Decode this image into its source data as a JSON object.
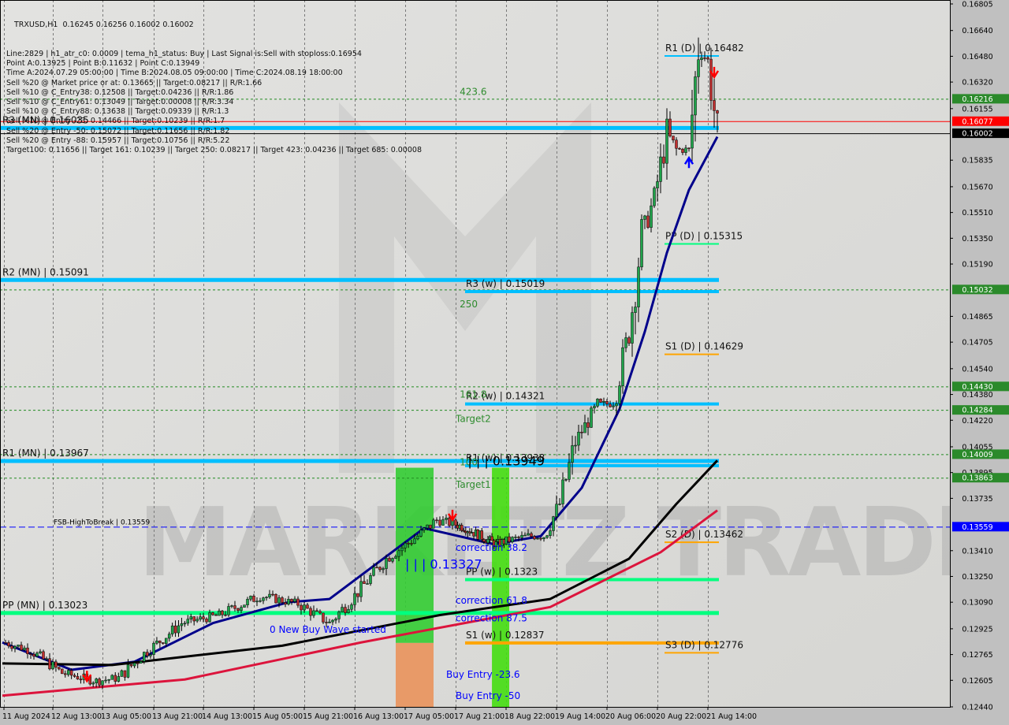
{
  "chart_data": {
    "type": "candlestick",
    "symbol_header": "TRXUSD,H1  0.16245 0.16256 0.16002 0.16002",
    "info_lines": [
      "Line:2829 | h1_atr_c0: 0.0009 | tema_h1_status: Buy | Last Signal is:Sell with stoploss:0.16954",
      "Point A:0.13925 | Point B:0.11632 | Point C:0.13949",
      "Time A:2024.07.29 05:00:00 | Time B:2024.08.05 09:00:00 | Time C:2024.08.19 18:00:00",
      "Sell %20 @ Market price or at: 0.13665 || Target:0.08217 || R/R:1.66",
      "Sell %10 @ C_Entry38: 0.12508 || Target:0.04236 || R/R:1.86",
      "Sell %10 @ C_Entry61: 0.13049 || Target:0.00008 || R/R:3.34",
      "Sell %10 @ C_Entry88: 0.13638 || Target:0.09339 || R/R:1.3",
      "Sell %10 @ Entry -23: 0.14466 || Target:0.10239 || R/R:1.7",
      "Sell %20 @ Entry -50: 0.15072 || Target:0.11656 || R/R:1.82",
      "Sell %20 @ Entry -88: 0.15957 || Target:0.10756 || R/R:5.22",
      "Target100: 0.11656 || Target 161: 0.10239 || Target 250: 0.08217 || Target 423: 0.04236 || Target 685: 0.00008"
    ],
    "ylim": [
      0.1244,
      0.16805
    ],
    "y_ticks": [
      "0.16805",
      "0.16640",
      "0.16480",
      "0.16320",
      "0.16155",
      "0.15835",
      "0.15670",
      "0.15510",
      "0.15350",
      "0.15190",
      "0.14865",
      "0.14705",
      "0.14540",
      "0.14380",
      "0.14220",
      "0.14055",
      "0.13895",
      "0.13735",
      "0.13410",
      "0.13250",
      "0.13090",
      "0.12925",
      "0.12765",
      "0.12605",
      "0.12440"
    ],
    "x_ticks": [
      "11 Aug 2024",
      "12 Aug 13:00",
      "13 Aug 05:00",
      "13 Aug 21:00",
      "14 Aug 13:00",
      "15 Aug 05:00",
      "15 Aug 21:00",
      "16 Aug 13:00",
      "17 Aug 05:00",
      "17 Aug 21:00",
      "18 Aug 22:00",
      "19 Aug 14:00",
      "20 Aug 06:00",
      "20 Aug 22:00",
      "21 Aug 14:00"
    ],
    "price_path": [
      [
        "11 Aug 22:00",
        0.1284
      ],
      [
        "12 Aug 06:00",
        0.1279
      ],
      [
        "12 Aug 16:00",
        0.1265
      ],
      [
        "13 Aug 03:00",
        0.126
      ],
      [
        "13 Aug 10:00",
        0.1262
      ],
      [
        "13 Aug 18:00",
        0.1277
      ],
      [
        "14 Aug 06:00",
        0.1296
      ],
      [
        "14 Aug 18:00",
        0.1301
      ],
      [
        "15 Aug 07:00",
        0.1313
      ],
      [
        "15 Aug 19:00",
        0.1308
      ],
      [
        "16 Aug 05:00",
        0.1296
      ],
      [
        "16 Aug 13:00",
        0.1313
      ],
      [
        "16 Aug 23:00",
        0.1336
      ],
      [
        "17 Aug 09:00",
        0.135
      ],
      [
        "17 Aug 15:00",
        0.136
      ],
      [
        "18 Aug 02:00",
        0.1355
      ],
      [
        "18 Aug 17:00",
        0.1345
      ],
      [
        "19 Aug 05:00",
        0.135
      ],
      [
        "19 Aug 10:00",
        0.135
      ],
      [
        "19 Aug 15:00",
        0.137
      ],
      [
        "19 Aug 20:00",
        0.1409
      ],
      [
        "20 Aug 03:00",
        0.1431
      ],
      [
        "20 Aug 08:00",
        0.1433
      ],
      [
        "20 Aug 13:00",
        0.1477
      ],
      [
        "20 Aug 17:00",
        0.1536
      ],
      [
        "20 Aug 21:00",
        0.156
      ],
      [
        "21 Aug 01:00",
        0.16
      ],
      [
        "21 Aug 04:00",
        0.159
      ],
      [
        "21 Aug 08:00",
        0.159
      ],
      [
        "21 Aug 11:00",
        0.1654
      ],
      [
        "21 Aug 14:00",
        0.1645
      ],
      [
        "21 Aug 17:00",
        0.16002
      ]
    ],
    "ma_lines": [
      {
        "color": "#00008b",
        "points": [
          [
            "11 Aug 21:00",
            0.1284
          ],
          [
            "12 Aug 19:00",
            0.1267
          ],
          [
            "13 Aug 15:00",
            0.1272
          ],
          [
            "14 Aug 16:00",
            0.1296
          ],
          [
            "15 Aug 16:00",
            0.1309
          ],
          [
            "16 Aug 05:00",
            0.1311
          ],
          [
            "17 Aug 11:00",
            0.1355
          ],
          [
            "18 Aug 16:00",
            0.1345
          ],
          [
            "19 Aug 09:00",
            0.135
          ],
          [
            "19 Aug 22:00",
            0.138
          ],
          [
            "20 Aug 10:00",
            0.1429
          ],
          [
            "20 Aug 18:00",
            0.1477
          ],
          [
            "21 Aug 01:00",
            0.1526
          ],
          [
            "21 Aug 08:00",
            0.1565
          ],
          [
            "21 Aug 17:00",
            0.1598
          ]
        ]
      },
      {
        "color": "#000000",
        "points": [
          [
            "11 Aug 21:00",
            0.1271
          ],
          [
            "13 Aug 08:00",
            0.127
          ],
          [
            "15 Aug 14:00",
            0.1282
          ],
          [
            "17 Aug 16:00",
            0.1301
          ],
          [
            "19 Aug 12:00",
            0.1311
          ],
          [
            "20 Aug 13:00",
            0.1336
          ],
          [
            "21 Aug 04:00",
            0.137
          ],
          [
            "21 Aug 17:00",
            0.1397
          ]
        ]
      },
      {
        "color": "#dc143c",
        "points": [
          [
            "11 Aug 21:00",
            0.1251
          ],
          [
            "14 Aug 07:00",
            0.1261
          ],
          [
            "16 Aug 15:00",
            0.1284
          ],
          [
            "19 Aug 12:00",
            0.1306
          ],
          [
            "20 Aug 23:00",
            0.134
          ],
          [
            "21 Aug 17:00",
            0.1366
          ]
        ]
      }
    ],
    "levels": [
      {
        "label": "R3 (MN) | 0.16035",
        "price": 0.16035,
        "color": "#00bfff",
        "span": "full",
        "width": 5
      },
      {
        "label": "R2 (MN) | 0.15091",
        "price": 0.15091,
        "color": "#00bfff",
        "span": "full",
        "width": 5
      },
      {
        "label": "R1 (MN) | 0.13967",
        "price": 0.13967,
        "color": "#00bfff",
        "span": "full",
        "width": 5
      },
      {
        "label": "PP (MN) | 0.13023",
        "price": 0.13023,
        "color": "#00ff7f",
        "span": "full",
        "width": 5
      },
      {
        "label": "R3 (w) | 0.15019",
        "price": 0.15019,
        "color": "#00bfff",
        "span": "weekly",
        "width": 4
      },
      {
        "label": "R2 (w) | 0.14321",
        "price": 0.14321,
        "color": "#00bfff",
        "span": "weekly",
        "width": 4
      },
      {
        "label": "R1 (w) | 0.13938",
        "price": 0.13938,
        "color": "#00bfff",
        "span": "weekly",
        "width": 4
      },
      {
        "label": "PP (w) | 0.1323",
        "price": 0.1323,
        "color": "#00ff7f",
        "span": "weekly",
        "width": 4
      },
      {
        "label": "S1 (w) | 0.12837",
        "price": 0.12837,
        "color": "#ffa500",
        "span": "weekly",
        "width": 4
      },
      {
        "label": "R1 (D) | 0.16482",
        "price": 0.16482,
        "color": "#00bfff",
        "span": "daily",
        "width": 2
      },
      {
        "label": "PP (D) | 0.15315",
        "price": 0.15315,
        "color": "#00ff7f",
        "span": "daily",
        "width": 2
      },
      {
        "label": "S1 (D) | 0.14629",
        "price": 0.14629,
        "color": "#ffa500",
        "span": "daily",
        "width": 2
      },
      {
        "label": "S2 (D) | 0.13462",
        "price": 0.13462,
        "color": "#ffa500",
        "span": "daily",
        "width": 2
      },
      {
        "label": "S3 (D) | 0.12776",
        "price": 0.12776,
        "color": "#ffa500",
        "span": "daily",
        "width": 2
      }
    ],
    "marked_prices": [
      {
        "value": "0.16216",
        "price": 0.16216,
        "color": "#228b22",
        "style": "dotted"
      },
      {
        "value": "0.15032",
        "price": 0.15032,
        "color": "#228b22",
        "style": "dotted"
      },
      {
        "value": "0.14430",
        "price": 0.1443,
        "color": "#228b22",
        "style": "dotted"
      },
      {
        "value": "0.14284",
        "price": 0.14284,
        "color": "#228b22",
        "style": "dotted"
      },
      {
        "value": "0.14009",
        "price": 0.14009,
        "color": "#228b22",
        "style": "dotted"
      },
      {
        "value": "0.13863",
        "price": 0.13863,
        "color": "#228b22",
        "style": "dotted"
      },
      {
        "value": "0.13559",
        "price": 0.13559,
        "color": "#0000ff",
        "style": "dashed"
      },
      {
        "value": "0.16002",
        "price": 0.16002,
        "color": "#000000",
        "style": "solid"
      },
      {
        "value": "0.16077",
        "price": 0.16077,
        "color": "#ff0000",
        "style": "solid"
      }
    ],
    "fsb_label": "FSB-HighToBreak | 0.13559",
    "annotations": [
      {
        "text": "423.6",
        "price": 0.1624,
        "at": "17 Aug 23:00",
        "color": "#2e8b2e"
      },
      {
        "text": "250",
        "price": 0.1492,
        "at": "17 Aug 23:00",
        "color": "#2e8b2e"
      },
      {
        "text": "161.8",
        "price": 0.1436,
        "at": "17 Aug 23:00",
        "color": "#2e8b2e"
      },
      {
        "text": "Target2",
        "price": 0.1421,
        "at": "17 Aug 21:00",
        "color": "#2e8b2e"
      },
      {
        "text": "100",
        "price": 0.1394,
        "at": "17 Aug 23:00",
        "color": "#2e8b2e"
      },
      {
        "text": "Target1",
        "price": 0.138,
        "at": "17 Aug 21:00",
        "color": "#2e8b2e"
      },
      {
        "text": "| | | 0.13949",
        "price": 0.1394,
        "at": "18 Aug 03:00",
        "color": "#000000",
        "big": true
      },
      {
        "text": "correction 38.2",
        "price": 0.1341,
        "at": "17 Aug 21:00",
        "color": "#0000ff"
      },
      {
        "text": "| | | 0.13327",
        "price": 0.133,
        "at": "17 Aug 05:00",
        "color": "#0000ff",
        "big": true
      },
      {
        "text": "correction 61.8",
        "price": 0.1308,
        "at": "17 Aug 21:00",
        "color": "#0000ff"
      },
      {
        "text": "correction 87.5",
        "price": 0.1297,
        "at": "17 Aug 21:00",
        "color": "#0000ff"
      },
      {
        "text": "Buy Entry -23.6",
        "price": 0.1262,
        "at": "17 Aug 18:00",
        "color": "#0000ff"
      },
      {
        "text": "Buy Entry -50",
        "price": 0.1249,
        "at": "17 Aug 21:00",
        "color": "#0000ff"
      },
      {
        "text": "0 New Buy Wave started",
        "price": 0.129,
        "at": "15 Aug 10:00",
        "color": "#0000ff"
      }
    ],
    "zones": [
      {
        "from": "17 Aug 02:00",
        "to": "17 Aug 14:00",
        "top": 0.13925,
        "mid": 0.12837,
        "upper_color": "#33cc33",
        "lower_color": "#e89a68"
      },
      {
        "from": "18 Aug 15:00",
        "to": "18 Aug 23:00",
        "top": 0.13925,
        "mid": null,
        "upper_color": "#44dd11",
        "lower_color": "#44dd11"
      }
    ],
    "watermark": "MARKETZ|TRADE",
    "colors": {
      "bull": "#1fa34a",
      "bear": "#000000",
      "background": "#dcdcda",
      "axis": "#c0c0c0"
    }
  }
}
